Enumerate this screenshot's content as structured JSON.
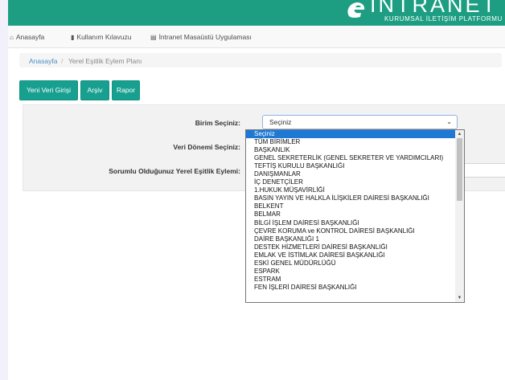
{
  "header": {
    "logo_title": "INTRANET",
    "logo_subtitle": "KURUMSAL İLETİŞİM PLATFORMU",
    "brand_color": "#1d9e82"
  },
  "topnav": {
    "items": [
      {
        "label": "Anasayfa",
        "icon": "home-icon"
      },
      {
        "label": "Kullanım Kılavuzu",
        "icon": "book-icon"
      },
      {
        "label": "İntranet Masaüstü Uygulaması",
        "icon": "desktop-icon"
      }
    ]
  },
  "breadcrumb": {
    "home": "Anasayfa",
    "separator": "/",
    "current": "Yerel Eşitlik Eylem Planı"
  },
  "actions": {
    "new_entry": "Yeni Veri Girişi",
    "archive": "Arşiv",
    "report": "Rapor",
    "button_color": "#17a08f"
  },
  "form": {
    "unit_label": "Birim Seçiniz:",
    "unit_value": "Seçiniz",
    "period_label": "Veri Dönemi Seçiniz:",
    "action_label": "Sorumlu Olduğunuz Yerel Eşitlik Eylemi:"
  },
  "dropdown": {
    "selected_color": "#1e79d5",
    "options": [
      "Seçiniz",
      "TÜM BİRİMLER",
      "BAŞKANLIK",
      "GENEL SEKRETERLİK (GENEL SEKRETER VE YARDIMCILARI)",
      "TEFTİŞ KURULU BAŞKANLIĞI",
      "DANIŞMANLAR",
      "İÇ DENETÇİLER",
      "1.HUKUK MÜŞAVİRLİĞİ",
      "BASIN YAYIN VE HALKLA İLİŞKİLER DAİRESİ BAŞKANLIĞI",
      "BELKENT",
      "BELMAR",
      "BİLGİ İŞLEM DAİRESİ BAŞKANLIĞI",
      "ÇEVRE KORUMA ve KONTROL DAİRESİ BAŞKANLIĞI",
      "DAİRE BAŞKANLIĞI 1",
      "DESTEK HİZMETLERİ DAİRESİ BAŞKANLIĞI",
      "EMLAK VE İSTİMLAK DAİRESİ BAŞKANLIĞI",
      "ESKİ GENEL MÜDÜRLÜĞÜ",
      "ESPARK",
      "ESTRAM",
      "FEN İŞLERİ DAİRESİ BAŞKANLIĞI"
    ]
  }
}
